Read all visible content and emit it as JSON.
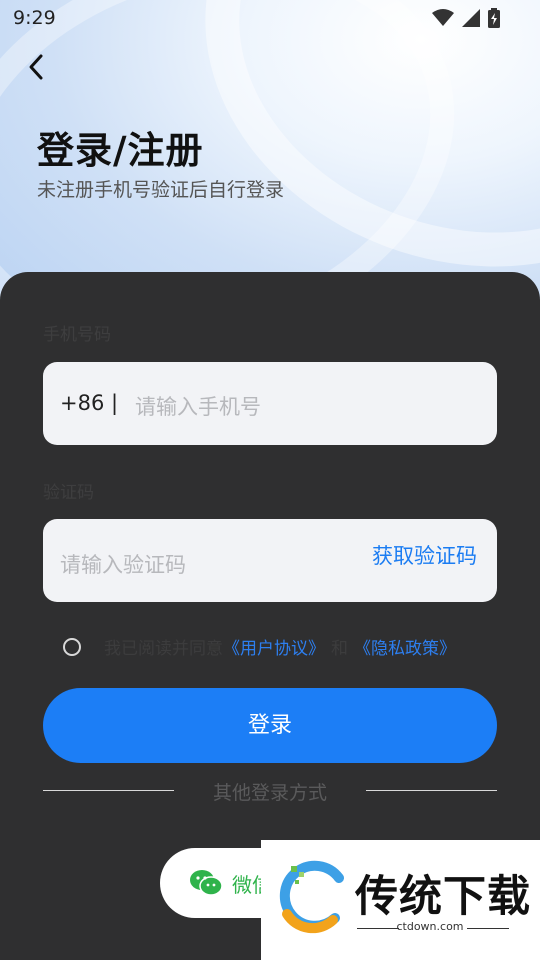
{
  "status": {
    "time": "9:29"
  },
  "header": {
    "title": "登录/注册",
    "subtitle": "未注册手机号验证后自行登录"
  },
  "form": {
    "phone_label": "手机号码",
    "country_code": "+86 |",
    "phone_placeholder": "请输入手机号",
    "code_label": "验证码",
    "code_placeholder": "请输入验证码",
    "get_code": "获取验证码"
  },
  "agreement": {
    "prefix": "我已阅读并同意",
    "user_agreement": "《用户协议》",
    "and": "和",
    "privacy_policy": "《隐私政策》"
  },
  "login_button": "登录",
  "other_methods": "其他登录方式",
  "wechat_label": "微信",
  "watermark": {
    "name": "传统下载",
    "domain": "ctdown.com"
  },
  "colors": {
    "accent": "#1c7ef6",
    "card": "#2f2f30",
    "wechat": "#2fb34b"
  }
}
